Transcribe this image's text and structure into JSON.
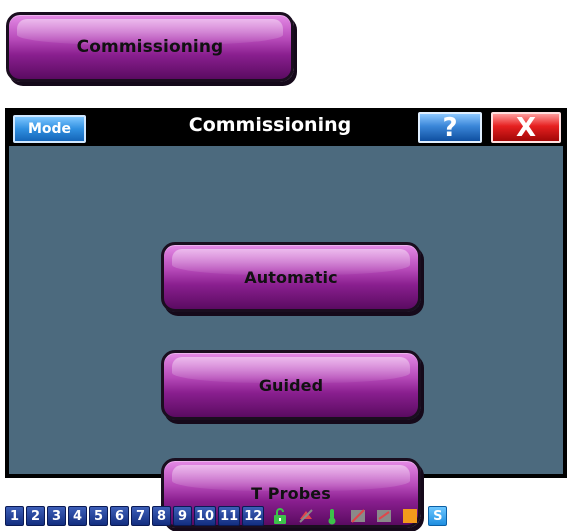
{
  "top_button": {
    "label": "Commissioning"
  },
  "window": {
    "mode_label": "Mode",
    "title": "Commissioning",
    "help_label": "?",
    "close_label": "X"
  },
  "menu": {
    "buttons": [
      {
        "label": "Automatic"
      },
      {
        "label": "Guided"
      },
      {
        "label": "T Probes"
      }
    ]
  },
  "statusbar": {
    "numbers": [
      "1",
      "2",
      "3",
      "4",
      "5",
      "6",
      "7",
      "8",
      "9",
      "10",
      "11",
      "12"
    ],
    "icons": [
      {
        "name": "unlock-icon",
        "color": "#3cc24a"
      },
      {
        "name": "alarm-off-icon",
        "color": "#e0464a"
      },
      {
        "name": "thermometer-icon",
        "color": "#3cc24a"
      },
      {
        "name": "fan-off-icon",
        "color": "#8a8a8a"
      },
      {
        "name": "valve-off-icon",
        "color": "#8a8a8a"
      },
      {
        "name": "warning-square-icon",
        "color": "#f29a1b"
      }
    ],
    "s_label": "S"
  },
  "colors": {
    "button_purple": "#8a1f8f",
    "panel_bg": "#4c6a7e",
    "mode_blue": "#2f8fe0",
    "close_red": "#e62020"
  }
}
